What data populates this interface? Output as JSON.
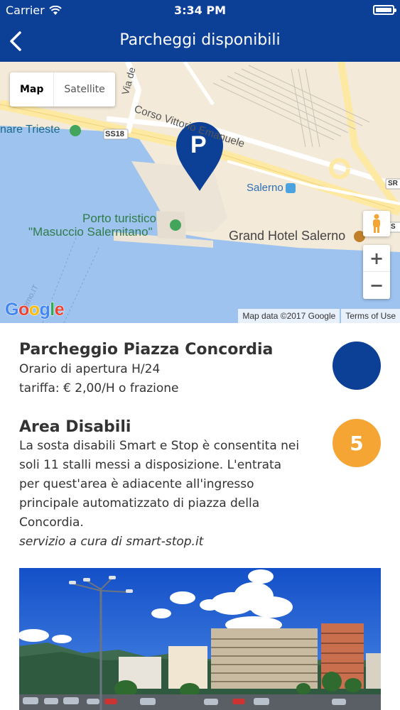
{
  "status": {
    "carrier": "Carrier",
    "time": "3:34 PM"
  },
  "nav": {
    "title": "Parcheggi disponibili"
  },
  "map": {
    "type_map": "Map",
    "type_satellite": "Satellite",
    "attribution": "Map data ©2017 Google",
    "terms": "Terms of Use",
    "logo": "Google",
    "zoom_in": "+",
    "zoom_out": "−",
    "labels": {
      "via_de": "Via de",
      "corso": "Corso Vittorio Emanuele",
      "trieste": "nare Trieste",
      "ss18": "SS18",
      "salerno": "Salerno",
      "porto_1": "Porto turistico",
      "porto_2": "\"Masuccio Salernitano\"",
      "grand_hotel": "Grand Hotel Salerno",
      "sr": "SR",
      "s": "S",
      "street": "erno.IT"
    },
    "marker_letter": "P",
    "colors": {
      "water": "#9ec3ee",
      "land": "#f3ead9",
      "marker": "#0c3f96",
      "road": "#fde9a2"
    }
  },
  "parking": {
    "title": "Parcheggio Piazza Concordia",
    "hours": "Orario di apertura H/24",
    "rate": "tariffa: € 2,00/H o frazione",
    "color": "#0c3f96"
  },
  "disabled": {
    "title": "Area Disabili",
    "lines": [
      "La sosta disabili Smart e Stop è consentita nei",
      "soli 11 stalli messi a disposizione. L'entrata",
      "per quest'area è adiacente all'ingresso",
      "principale automatizzato di piazza della",
      "Concordia."
    ],
    "credit": "servizio a cura di smart-stop.it",
    "count": "5",
    "color": "#f4a533"
  }
}
